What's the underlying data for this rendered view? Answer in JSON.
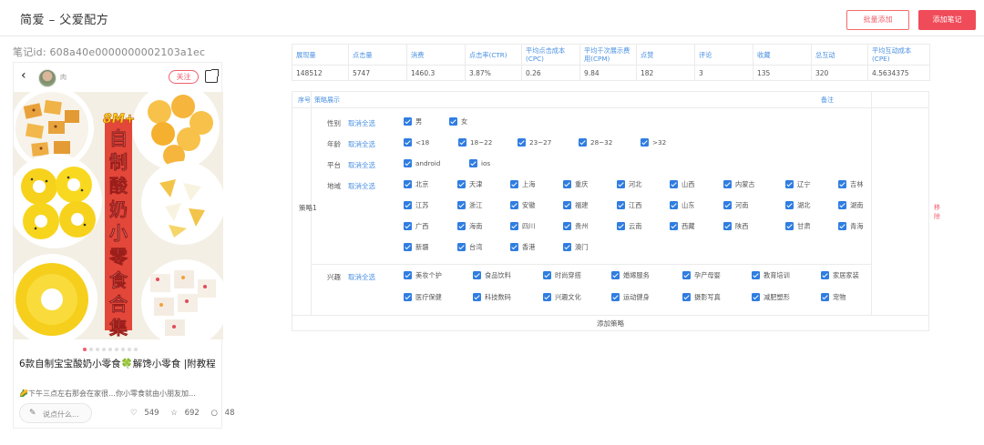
{
  "header": {
    "title": "简爱 – 父爱配方",
    "batch_add": "批量添加",
    "add_note": "添加笔记"
  },
  "note": {
    "id_label": "笔记id:  608a40e0000000002103a1ec",
    "back": "‹",
    "author": "肉",
    "follow": "关注",
    "cover_badge": "8M+",
    "cover_text": "自制酸奶小零食合集",
    "title": "6款自制宝宝酸奶小零食🍀解馋小零食 |附教程",
    "desc": "🌽下午三点左右那会在家很…你小零食就由小朋友加…",
    "comment_placeholder": "说点什么...",
    "likes": "549",
    "collects": "692",
    "comments": "48"
  },
  "metrics": {
    "headers": [
      "展现量",
      "点击量",
      "消费",
      "点击率(CTR)",
      "平均点击成本(CPC)",
      "平均千次展示费用(CPM)",
      "点赞",
      "评论",
      "收藏",
      "总互动",
      "平均互动成本(CPE)"
    ],
    "values": [
      "148512",
      "5747",
      "1460.3",
      "3.87%",
      "0.26",
      "9.84",
      "182",
      "3",
      "135",
      "320",
      "4.5634375"
    ]
  },
  "strategy": {
    "col_index": "序号",
    "col_display": "策略展示",
    "col_note": "备注",
    "plan_name": "策略1",
    "remove": "移除",
    "clear": "取消全选",
    "add_plan": "添加策略",
    "gender": {
      "label": "性别",
      "options": [
        "男",
        "女"
      ]
    },
    "age": {
      "label": "年龄",
      "options": [
        "<18",
        "18~22",
        "23~27",
        "28~32",
        ">32"
      ]
    },
    "platform": {
      "label": "平台",
      "options": [
        "android",
        "ios"
      ]
    },
    "region": {
      "label": "地域",
      "options": [
        "北京",
        "天津",
        "上海",
        "重庆",
        "河北",
        "山西",
        "内蒙古",
        "辽宁",
        "吉林",
        "江苏",
        "浙江",
        "安徽",
        "福建",
        "江西",
        "山东",
        "河南",
        "湖北",
        "湖南",
        "广西",
        "海南",
        "四川",
        "贵州",
        "云南",
        "西藏",
        "陕西",
        "甘肃",
        "青海",
        "新疆",
        "台湾",
        "香港",
        "澳门"
      ]
    },
    "interest": {
      "label": "兴趣",
      "options": [
        "美妆个护",
        "食品饮料",
        "时尚穿搭",
        "婚嫁服务",
        "孕产母婴",
        "教育培训",
        "家居家装",
        "医疗保健",
        "科技数码",
        "兴趣文化",
        "运动健身",
        "摄影写真",
        "减肥塑形",
        "宠物"
      ]
    }
  },
  "colors": {
    "accent": "#ef4b59",
    "link": "#4a90e2",
    "checkbox": "#2f7de1"
  }
}
